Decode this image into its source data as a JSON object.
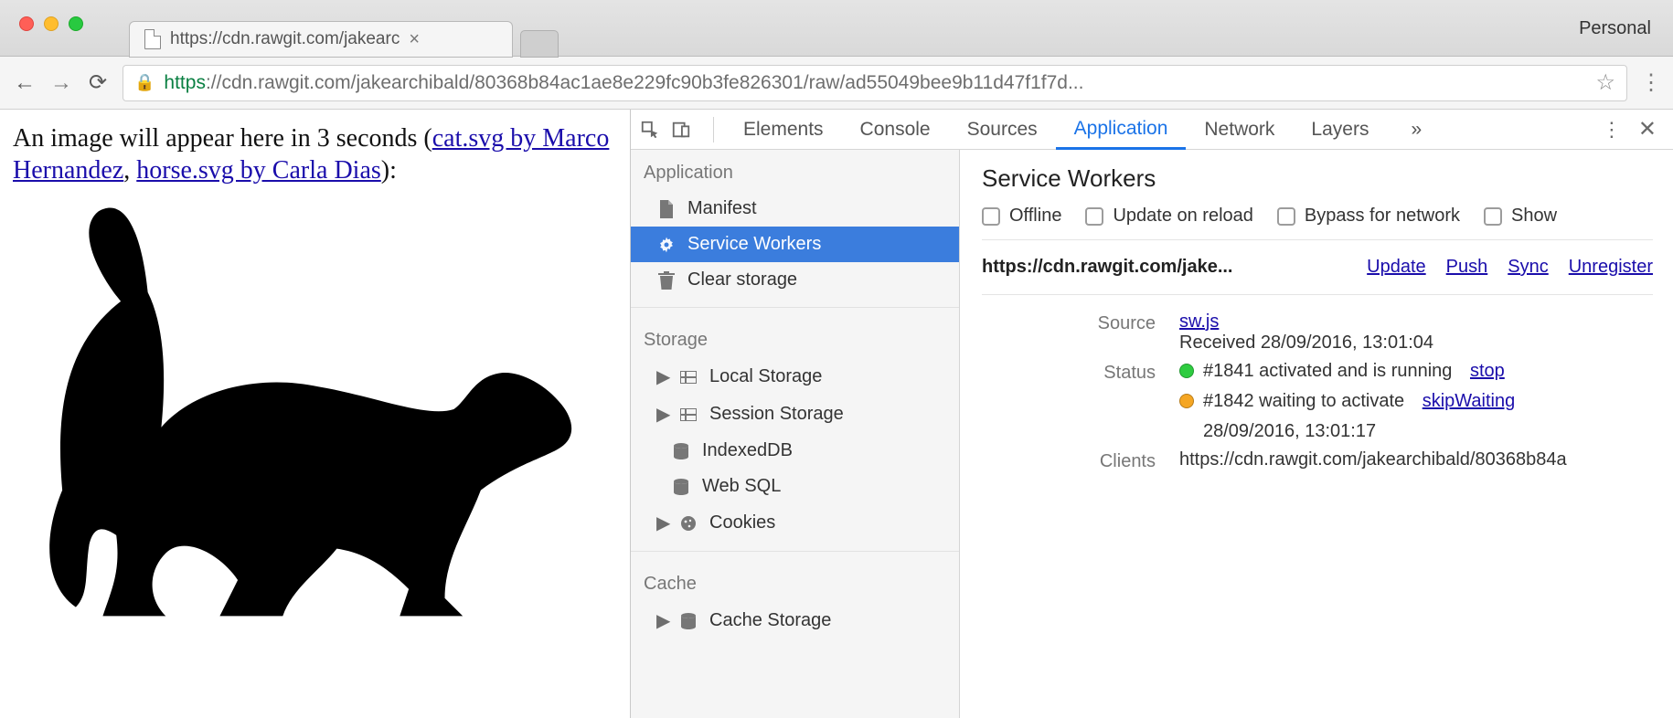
{
  "chrome": {
    "profile_label": "Personal",
    "tab_title": "https://cdn.rawgit.com/jakearc",
    "url_scheme": "https",
    "url_host_path": "://cdn.rawgit.com/jakearchibald/80368b84ac1ae8e229fc90b3fe826301/raw/ad55049bee9b11d47f1f7d..."
  },
  "page": {
    "intro_prefix": "An image will appear here in 3 seconds (",
    "link1": "cat.svg by Marco Hernandez",
    "sep": ", ",
    "link2": "horse.svg by Carla Dias",
    "intro_suffix": "):"
  },
  "devtools": {
    "tabs": [
      "Elements",
      "Console",
      "Sources",
      "Application",
      "Network",
      "Layers"
    ],
    "active_tab": "Application",
    "overflow": "»",
    "sidebar": {
      "groups": [
        {
          "title": "Application",
          "items": [
            {
              "name": "manifest",
              "label": "Manifest",
              "icon": "file"
            },
            {
              "name": "service-workers",
              "label": "Service Workers",
              "icon": "gear",
              "selected": true
            },
            {
              "name": "clear-storage",
              "label": "Clear storage",
              "icon": "trash"
            }
          ]
        },
        {
          "title": "Storage",
          "items": [
            {
              "name": "local-storage",
              "label": "Local Storage",
              "icon": "grid",
              "expand": true
            },
            {
              "name": "session-storage",
              "label": "Session Storage",
              "icon": "grid",
              "expand": true
            },
            {
              "name": "indexeddb",
              "label": "IndexedDB",
              "icon": "db"
            },
            {
              "name": "web-sql",
              "label": "Web SQL",
              "icon": "db"
            },
            {
              "name": "cookies",
              "label": "Cookies",
              "icon": "cookie",
              "expand": true
            }
          ]
        },
        {
          "title": "Cache",
          "items": [
            {
              "name": "cache-storage",
              "label": "Cache Storage",
              "icon": "db",
              "expand": true
            }
          ]
        }
      ]
    },
    "panel": {
      "title": "Service Workers",
      "options": [
        "Offline",
        "Update on reload",
        "Bypass for network",
        "Show"
      ],
      "origin": "https://cdn.rawgit.com/jake...",
      "actions": [
        "Update",
        "Push",
        "Sync",
        "Unregister"
      ],
      "source_label": "Source",
      "source_link": "sw.js",
      "source_received": "Received 28/09/2016, 13:01:04",
      "status_label": "Status",
      "status_active_text": "#1841 activated and is running",
      "status_active_action": "stop",
      "status_waiting_text": "#1842 waiting to activate",
      "status_waiting_action": "skipWaiting",
      "status_waiting_time": "28/09/2016, 13:01:17",
      "clients_label": "Clients",
      "clients_value": "https://cdn.rawgit.com/jakearchibald/80368b84a"
    }
  }
}
